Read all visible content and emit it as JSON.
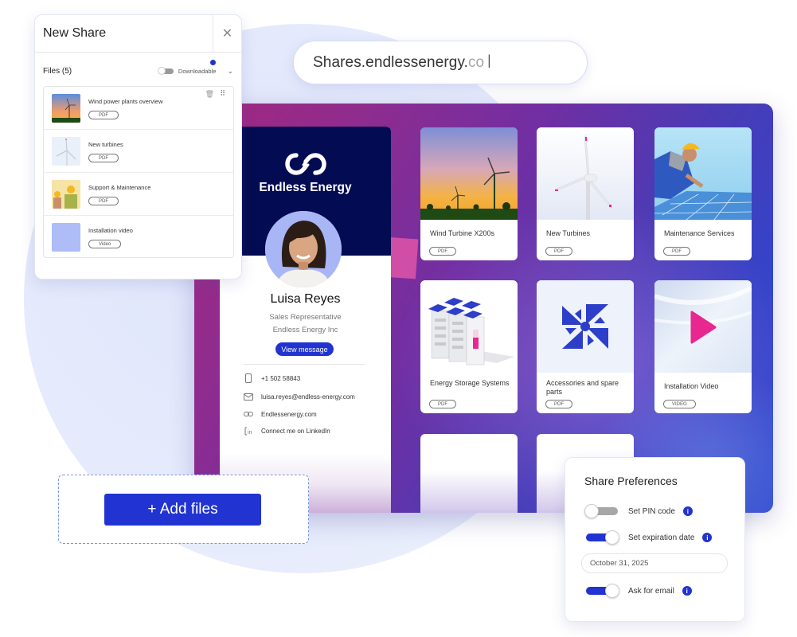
{
  "url_bar": {
    "typed": "Shares.endlessenergy.",
    "suggestion": "co",
    "cursor_icon": "text-cursor-icon"
  },
  "new_share": {
    "title": "New Share",
    "close_icon": "close-icon",
    "files_label": "Files (5)",
    "downloadable_label": "Downloadable",
    "downloadable_on": false,
    "files": [
      {
        "name": "Wind power plants overview",
        "type": "PDF",
        "thumb": "wind-sunset"
      },
      {
        "name": "New turbines",
        "type": "PDF",
        "thumb": "white-turbine"
      },
      {
        "name": "Support & Maintenance",
        "type": "PDF",
        "thumb": "workers"
      },
      {
        "name": "Installation video",
        "type": "Video",
        "thumb": "blue-square"
      }
    ]
  },
  "profile": {
    "brand": "Endless Energy",
    "name": "Luisa Reyes",
    "role": "Sales Representative",
    "company": "Endless Energy Inc",
    "view_message": "View message",
    "contacts": [
      {
        "icon": "phone-icon",
        "text": "+1 502 58843"
      },
      {
        "icon": "mail-icon",
        "text": "luisa.reyes@endless-energy.com"
      },
      {
        "icon": "link-icon",
        "text": "Endlessenergy.com"
      },
      {
        "icon": "linkedin-icon",
        "text": "Connect me on LinkedIn"
      }
    ]
  },
  "tiles": [
    {
      "title": "Wind Turbine X200s",
      "tag": "PDF"
    },
    {
      "title": "New Turbines",
      "tag": "PDF"
    },
    {
      "title": "Maintenance Services",
      "tag": "PDF"
    },
    {
      "title": "Energy Storage Systems",
      "tag": "PDF"
    },
    {
      "title": "Accessories and spare parts",
      "tag": "PDF"
    },
    {
      "title": "Installation Video",
      "tag": "VIDEO"
    }
  ],
  "add_files": {
    "label": "+ Add files"
  },
  "preferences": {
    "title": "Share Preferences",
    "pin": {
      "label": "Set PIN code",
      "on": false
    },
    "expiration": {
      "label": "Set expiration date",
      "on": true,
      "date": "October 31, 2025"
    },
    "ask_email": {
      "label": "Ask for email",
      "on": true
    },
    "info_glyph": "i"
  },
  "colors": {
    "accent": "#2134d1",
    "brand_navy": "#030b52",
    "play_pink": "#e8288f"
  }
}
